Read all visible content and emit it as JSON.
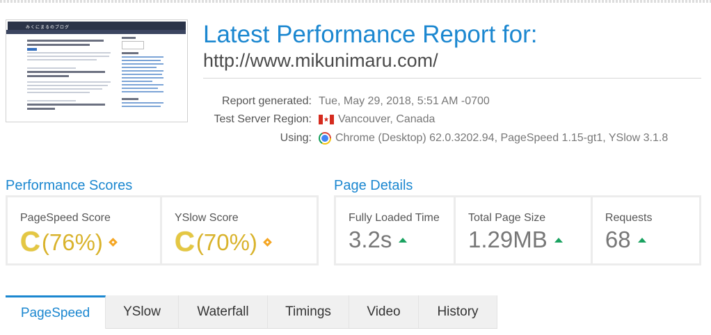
{
  "thumbnail": {
    "site_title": "みくにまるのブログ"
  },
  "report": {
    "title": "Latest Performance Report for:",
    "url": "http://www.mikunimaru.com/",
    "generated_label": "Report generated:",
    "generated_value": "Tue, May 29, 2018, 5:51 AM -0700",
    "region_label": "Test Server Region:",
    "region_value": "Vancouver, Canada",
    "using_label": "Using:",
    "using_value": "Chrome (Desktop) 62.0.3202.94, PageSpeed 1.15-gt1, YSlow 3.1.8"
  },
  "performance": {
    "title": "Performance Scores",
    "pagespeed": {
      "label": "PageSpeed Score",
      "grade": "C",
      "percent": "(76%)"
    },
    "yslow": {
      "label": "YSlow Score",
      "grade": "C",
      "percent": "(70%)"
    }
  },
  "page_details": {
    "title": "Page Details",
    "load_time": {
      "label": "Fully Loaded Time",
      "value": "3.2s"
    },
    "page_size": {
      "label": "Total Page Size",
      "value": "1.29MB"
    },
    "requests": {
      "label": "Requests",
      "value": "68"
    }
  },
  "tabs": [
    "PageSpeed",
    "YSlow",
    "Waterfall",
    "Timings",
    "Video",
    "History"
  ],
  "active_tab": "PageSpeed",
  "colors": {
    "accent": "#1b87d0",
    "grade_c": "#e4c743",
    "trend_up": "#1aa260",
    "warning": "#f5a623"
  }
}
